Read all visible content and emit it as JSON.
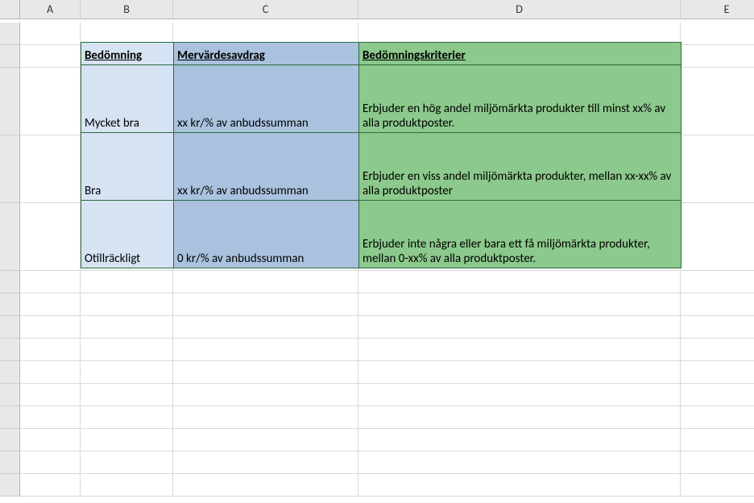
{
  "columns": [
    "",
    "A",
    "B",
    "C",
    "D",
    "E"
  ],
  "headers": {
    "b": "Bedömning",
    "c": "Mervärdesavdrag",
    "d": "Bedömningskriterier"
  },
  "rows": [
    {
      "b": "Mycket bra",
      "c": "xx kr/% av anbudssumman",
      "d": "Erbjuder en hög andel miljömärkta produkter till minst xx% av alla produktposter."
    },
    {
      "b": "Bra",
      "c": "xx kr/% av anbudssumman",
      "d": "Erbjuder en viss andel miljömärkta produkter, mellan xx-xx% av alla produktposter"
    },
    {
      "b": "Otillräckligt",
      "c": "0 kr/% av anbudssumman",
      "d": "Erbjuder inte några eller bara ett få miljömärkta produkter, mellan 0-xx% av alla produktposter."
    }
  ]
}
